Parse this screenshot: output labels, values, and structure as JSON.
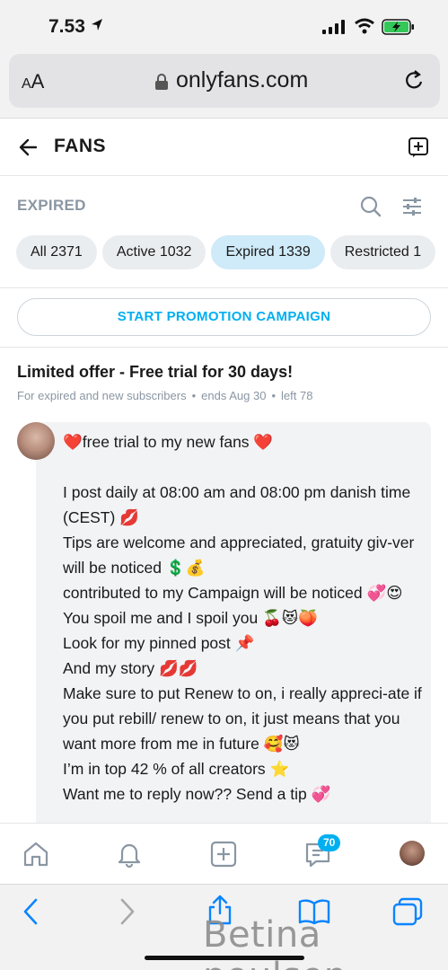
{
  "status": {
    "time": "7.53"
  },
  "browser": {
    "aa_small": "A",
    "aa_big": "A",
    "url": "onlyfans.com"
  },
  "header": {
    "title": "FANS"
  },
  "list": {
    "label": "EXPIRED"
  },
  "chips": [
    {
      "label": "All 2371",
      "active": false
    },
    {
      "label": "Active 1032",
      "active": false
    },
    {
      "label": "Expired 1339",
      "active": true
    },
    {
      "label": "Restricted 1",
      "active": false
    }
  ],
  "promo": {
    "button_label": "START PROMOTION CAMPAIGN"
  },
  "offer": {
    "title": "Limited offer - Free trial for 30 days!",
    "audience": "For expired and new subscribers",
    "ends": "ends Aug 30",
    "left": "left 78"
  },
  "message": {
    "lines": [
      "❤️free trial to my new fans ❤️",
      "",
      "I post daily at 08:00 am and 08:00 pm danish time (CEST) 💋",
      "Tips are welcome and appreciated, gratuity giv-ver will be noticed 💲💰",
      "contributed to my Campaign will be noticed 💞😍",
      "You spoil me and I spoil you 🍒😻🍑",
      "Look for my pinned post 📌",
      "And my story 💋💋",
      "Make sure to put Renew to on, i really appreci-ate if you put rebill/ renew to on, it just means that you want more from me in future 🥰😻",
      "I’m in top 42 % of all creators ⭐",
      "Want me to reply now?? Send a tip 💞"
    ]
  },
  "nav": {
    "messages_badge": "70"
  },
  "watermark": "Betina poulsen",
  "colors": {
    "accent": "#00aff0",
    "chip_bg": "#eaedf0",
    "chip_active_bg": "#cfeaf8",
    "muted": "#8a96a3"
  }
}
